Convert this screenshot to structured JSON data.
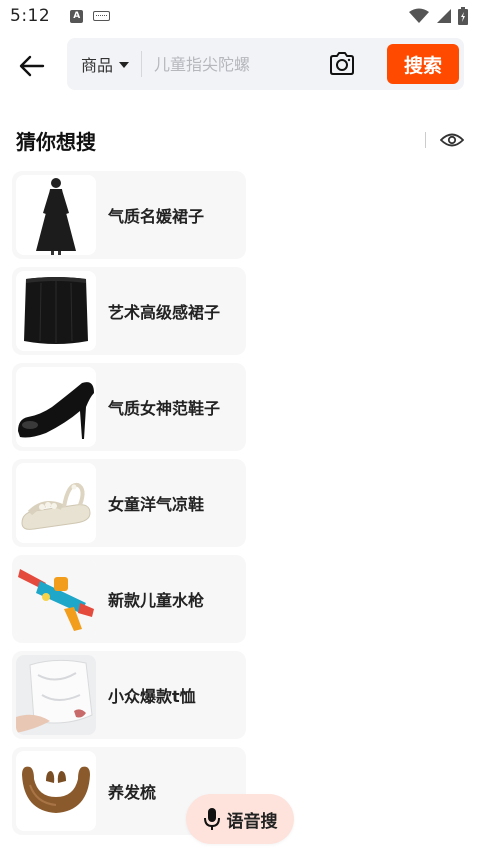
{
  "status_bar": {
    "time": "5:12"
  },
  "search": {
    "category": "商品",
    "placeholder": "儿童指尖陀螺",
    "button_label": "搜索"
  },
  "section": {
    "title": "猜你想搜"
  },
  "suggestions": [
    {
      "label": "气质名媛裙子",
      "icon": "black-dress-image"
    },
    {
      "label": "艺术高级感裙子",
      "icon": "black-skirt-image"
    },
    {
      "label": "气质女神范鞋子",
      "icon": "black-high-heel-image"
    },
    {
      "label": "女童洋气凉鞋",
      "icon": "girls-sandal-image"
    },
    {
      "label": "新款儿童水枪",
      "icon": "water-gun-image"
    },
    {
      "label": "小众爆款t恤",
      "icon": "white-tshirt-image"
    },
    {
      "label": "养发梳",
      "icon": "wooden-comb-image"
    }
  ],
  "voice": {
    "label": "语音搜"
  },
  "colors": {
    "accent": "#ff4a00",
    "voice_bg": "#fde3dc",
    "search_bg": "#f2f3f7",
    "card_bg": "#f7f7f8"
  }
}
